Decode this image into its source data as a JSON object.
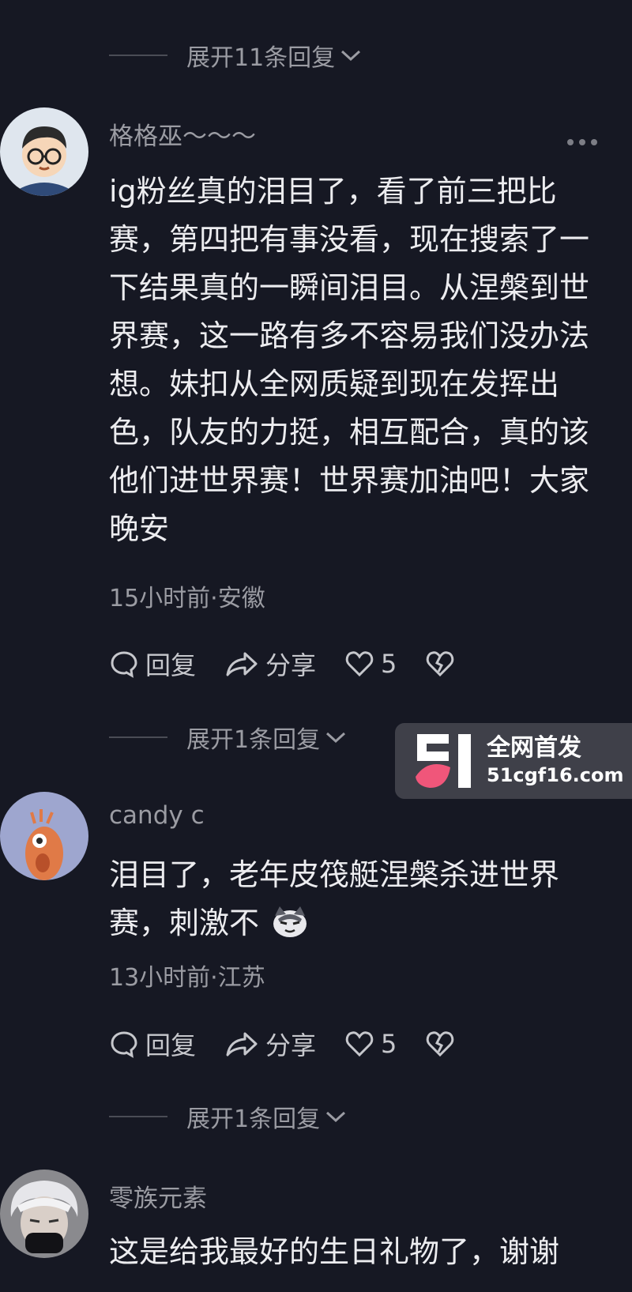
{
  "expand": [
    "展开11条回复",
    "展开1条回复",
    "展开1条回复"
  ],
  "comments": [
    {
      "user": "格格巫～～～",
      "text": "ig粉丝真的泪目了，看了前三把比赛，第四把有事没看，现在搜索了一下结果真的一瞬间泪目。从涅槃到世界赛，这一路有多不容易我们没办法想。妹扣从全网质疑到现在发挥出色，队友的力挺，相互配合，真的该他们进世界赛！世界赛加油吧！大家晚安",
      "meta": "15小时前·安徽",
      "reply": "回复",
      "share": "分享",
      "likes": "5"
    },
    {
      "user": "candy c",
      "text": "泪目了，老年皮筏艇涅槃杀进世界赛，刺激不",
      "meta": "13小时前·江苏",
      "reply": "回复",
      "share": "分享",
      "likes": "5"
    },
    {
      "user": "零族元素",
      "text": "这是给我最好的生日礼物了，谢谢"
    }
  ],
  "watermark": {
    "line1": "全网首发",
    "line2": "51cgf16.com",
    "logo": "51"
  },
  "icons": {
    "reply": "comment-bubble-icon",
    "share": "share-arrow-icon",
    "like": "heart-icon",
    "dislike": "broken-heart-icon",
    "more": "more-dots-icon",
    "expand": "chevron-down-icon"
  },
  "colors": {
    "background": "#161823",
    "muted": "#9b9ca3",
    "text": "#ececef",
    "watermark_pink": "#f0567a"
  }
}
